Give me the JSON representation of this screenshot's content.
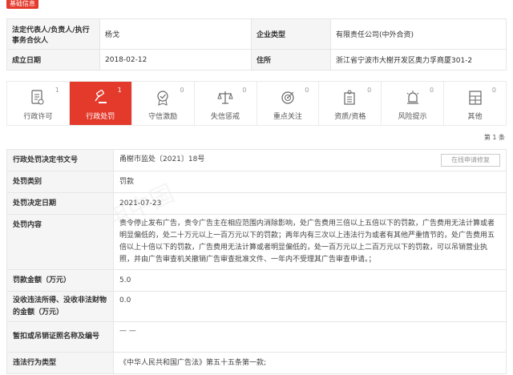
{
  "section_title": "基础信息",
  "basic_info": {
    "legal_rep_label": "法定代表人/负责人/执行事务合伙人",
    "legal_rep_value": "杨戈",
    "company_type_label": "企业类型",
    "company_type_value": "有限责任公司(中外合资)",
    "founded_label": "成立日期",
    "founded_value": "2018-02-12",
    "address_label": "住所",
    "address_value": "浙江省宁波市大榭开发区奥力孚商厦301-2"
  },
  "tabs": [
    {
      "label": "行政许可",
      "count": "1",
      "icon": "document-icon"
    },
    {
      "label": "行政处罚",
      "count": "1",
      "icon": "gavel-icon"
    },
    {
      "label": "守信激励",
      "count": "0",
      "icon": "reward-icon"
    },
    {
      "label": "失信惩戒",
      "count": "0",
      "icon": "scale-icon"
    },
    {
      "label": "重点关注",
      "count": "0",
      "icon": "target-icon"
    },
    {
      "label": "资质/资格",
      "count": "0",
      "icon": "certificate-icon"
    },
    {
      "label": "风险提示",
      "count": "0",
      "icon": "alarm-icon"
    },
    {
      "label": "其他",
      "count": "0",
      "icon": "grid-icon"
    }
  ],
  "pager": "第 1 条",
  "detail": {
    "doc_no_label": "行政处罚决定书文号",
    "doc_no_value": "甬榭市监处〔2021〕18号",
    "apply_button": "在线申请修复",
    "category_label": "处罚类别",
    "category_value": "罚款",
    "date_label": "处罚决定日期",
    "date_value": "2021-07-23",
    "content_label": "处罚内容",
    "content_value": "责令停止发布广告，责令广告主在相应范围内消除影响，处广告费用三倍以上五倍以下的罚款，广告费用无法计算或者明显偏低的，处二十万元以上一百万元以下的罚款；两年内有三次以上违法行为或者有其他严重情节的，处广告费用五倍以上十倍以下的罚款，广告费用无法计算或者明显偏低的，处一百万元以上二百万元以下的罚款，可以吊销营业执照，并由广告审查机关撤销广告审查批准文件、一年内不受理其广告审查申请。；",
    "amount_label": "罚款金额（万元）",
    "amount_value": "5.0",
    "confiscated_label": "没收违法所得、没收非法财物的金额（万元）",
    "confiscated_value": "0.0",
    "license_label": "暂扣或吊销证照名称及编号",
    "license_value": "— —",
    "violation_label": "违法行为类型",
    "violation_value": "《中华人民共和国广告法》第五十五条第一款;"
  }
}
